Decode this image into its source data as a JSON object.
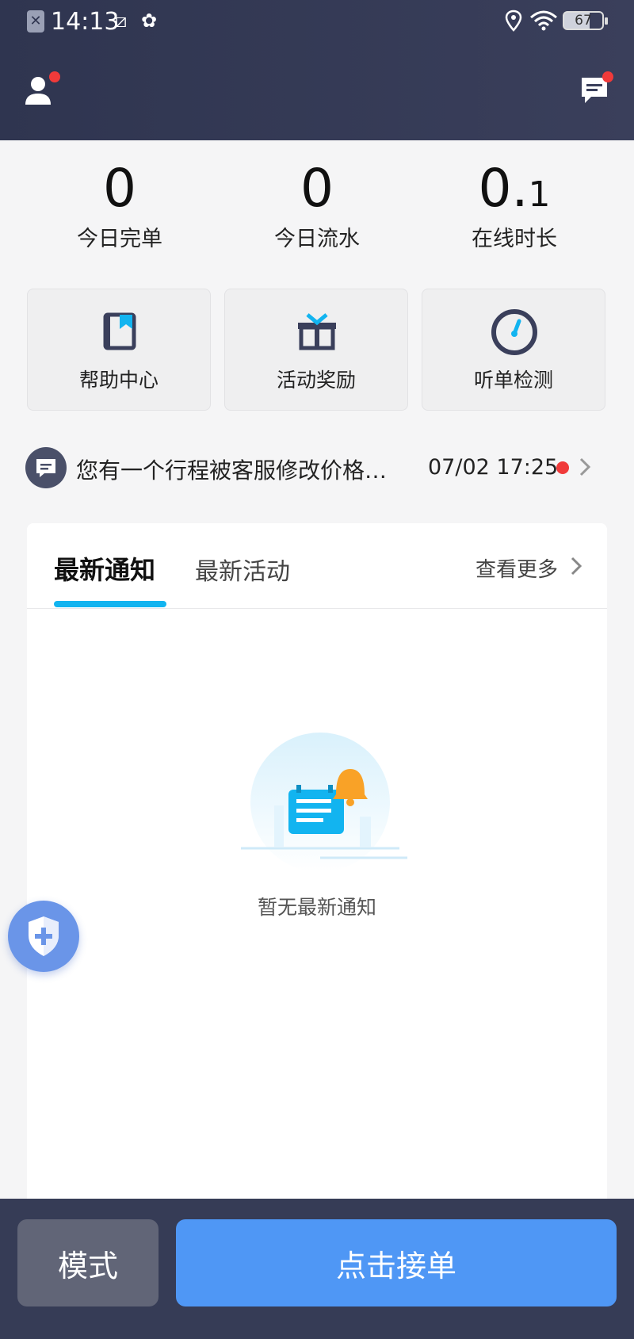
{
  "status_bar": {
    "sim_label": "✕",
    "time": "14:13",
    "battery": "67"
  },
  "header": {
    "user_icon": "user-icon",
    "message_icon": "message-icon"
  },
  "stats": [
    {
      "value": "0",
      "label": "今日完单"
    },
    {
      "value": "0",
      "label": "今日流水"
    },
    {
      "value_main": "0.",
      "value_small": "1",
      "label": "在线时长"
    }
  ],
  "tiles": [
    {
      "label": "帮助中心",
      "icon": "book-icon"
    },
    {
      "label": "活动奖励",
      "icon": "gift-icon"
    },
    {
      "label": "听单检测",
      "icon": "gauge-icon"
    }
  ],
  "notice": {
    "text": "您有一个行程被客服修改价格…",
    "time": "07/02 17:25"
  },
  "card": {
    "tabs": [
      "最新通知",
      "最新活动"
    ],
    "more": "查看更多",
    "empty_text": "暂无最新通知"
  },
  "bottom": {
    "mode_label": "模式",
    "accept_label": "点击接单"
  },
  "colors": {
    "header_bg": "#2f3550",
    "accent": "#4f97f5",
    "tab_underline": "#12b4f0",
    "red_dot": "#f03a3a"
  }
}
